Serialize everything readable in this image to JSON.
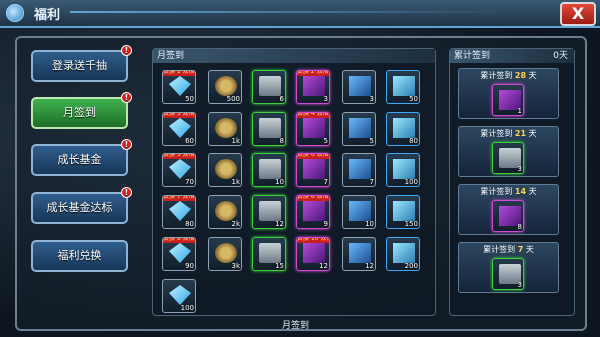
{
  "window": {
    "title": "福利",
    "close_label": "X"
  },
  "menu": [
    {
      "label": "登录送千抽",
      "badge": "!",
      "active": false
    },
    {
      "label": "月签到",
      "badge": "!",
      "active": true
    },
    {
      "label": "成长基金",
      "badge": "!",
      "active": false
    },
    {
      "label": "成长基金达标",
      "badge": "!",
      "active": false
    },
    {
      "label": "福利兑换",
      "badge": "",
      "active": false
    }
  ],
  "monthly": {
    "title": "月签到",
    "subtitle": "月签到",
    "rows": [
      {
        "ribbon": "贵族 1 双倍",
        "items": [
          {
            "type": "diamond",
            "count": "50"
          },
          {
            "type": "coin",
            "count": "500"
          },
          {
            "type": "chest",
            "count": "6"
          },
          {
            "type": "purple",
            "count": "3",
            "ribbon": "贵族 2 双倍"
          },
          {
            "type": "blue",
            "count": "3"
          },
          {
            "type": "bar",
            "count": "50"
          }
        ]
      },
      {
        "ribbon": "贵族 3 双倍",
        "items": [
          {
            "type": "diamond",
            "count": "60"
          },
          {
            "type": "coin",
            "count": "1k"
          },
          {
            "type": "chest",
            "count": "8"
          },
          {
            "type": "purple",
            "count": "5",
            "ribbon": "贵族 4 双倍"
          },
          {
            "type": "blue",
            "count": "5"
          },
          {
            "type": "bar",
            "count": "80"
          }
        ]
      },
      {
        "ribbon": "贵族 5 双倍",
        "items": [
          {
            "type": "diamond",
            "count": "70"
          },
          {
            "type": "coin",
            "count": "1k"
          },
          {
            "type": "chest",
            "count": "10"
          },
          {
            "type": "purple",
            "count": "7",
            "ribbon": "贵族 6 双倍"
          },
          {
            "type": "blue",
            "count": "7"
          },
          {
            "type": "bar",
            "count": "100"
          }
        ]
      },
      {
        "ribbon": "贵族 7 双倍",
        "items": [
          {
            "type": "diamond",
            "count": "80"
          },
          {
            "type": "coin",
            "count": "2k"
          },
          {
            "type": "chest",
            "count": "12"
          },
          {
            "type": "purple",
            "count": "9",
            "ribbon": "贵族 8 双倍"
          },
          {
            "type": "blue",
            "count": "10"
          },
          {
            "type": "bar",
            "count": "150"
          }
        ]
      },
      {
        "ribbon": "贵族 9 双倍",
        "items": [
          {
            "type": "diamond",
            "count": "90"
          },
          {
            "type": "coin",
            "count": "3k"
          },
          {
            "type": "chest",
            "count": "15"
          },
          {
            "type": "purple",
            "count": "12",
            "ribbon": "贵族 10 双倍"
          },
          {
            "type": "blue",
            "count": "12"
          },
          {
            "type": "bar",
            "count": "200"
          }
        ]
      },
      {
        "ribbon": "",
        "items": [
          {
            "type": "diamond",
            "count": "100"
          }
        ]
      }
    ]
  },
  "cumulative": {
    "title": "累计签到",
    "count": "0天",
    "entries": [
      {
        "prefix": "累计签到",
        "days": "28",
        "suffix": "天",
        "item": "purple",
        "item_count": "1"
      },
      {
        "prefix": "累计签到",
        "days": "21",
        "suffix": "天",
        "item": "chest",
        "item_count": "3"
      },
      {
        "prefix": "累计签到",
        "days": "14",
        "suffix": "天",
        "item": "purple",
        "item_count": "8"
      },
      {
        "prefix": "累计签到",
        "days": "7",
        "suffix": "天",
        "item": "chest",
        "item_count": "3"
      }
    ]
  },
  "colors": {
    "accent": "#5fa5d6",
    "active_green": "#3fb24f",
    "close_red": "#e24a3a",
    "highlight_days": "#ffd24a"
  }
}
